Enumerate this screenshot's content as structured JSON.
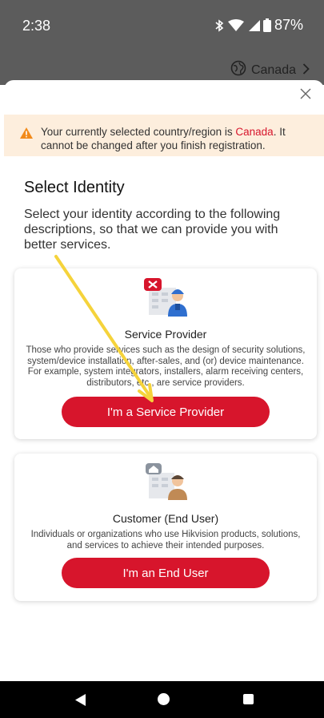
{
  "status_bar": {
    "time": "2:38",
    "battery": "87%",
    "icons": [
      "bluetooth-icon",
      "wifi-icon",
      "signal-icon",
      "battery-icon"
    ]
  },
  "header": {
    "region": "Canada",
    "region_icon": "globe-icon"
  },
  "notice": {
    "text_before": "Your currently selected country/region is ",
    "country": "Canada",
    "text_after": ". It cannot be changed after you finish registration.",
    "icon": "warning-icon",
    "highlight_color": "#d7152c"
  },
  "page": {
    "title": "Select Identity",
    "description": "Select your identity according to the following descriptions, so that we can provide you with better services."
  },
  "cards": [
    {
      "title": "Service Provider",
      "description": "Those who provide services such as the design of security solutions, system/device installation, after-sales, and (or) device maintenance. For example, system integrators, installers, alarm receiving centers, distributors, etc., are service providers.",
      "button": "I'm a Service Provider",
      "icon": "service-provider-icon"
    },
    {
      "title": "Customer (End User)",
      "description": "Individuals or organizations who use Hikvision products, solutions, and services to achieve their intended purposes.",
      "button": "I'm an End User",
      "icon": "end-user-icon"
    }
  ],
  "colors": {
    "accent": "#d7152c",
    "notice_bg": "#fdeedd",
    "annotation_arrow": "#f5d33b"
  }
}
